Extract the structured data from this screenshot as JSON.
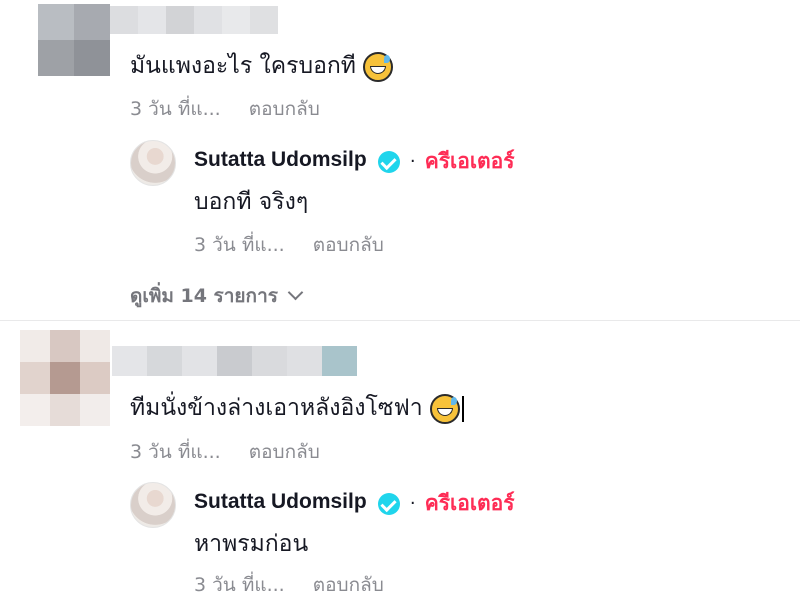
{
  "comments": [
    {
      "text": "มันแพงอะไร ใครบอกที",
      "emoji": "sweat-smile-emoji",
      "time": "3 วัน ที่แ...",
      "reply_label": "ตอบกลับ",
      "reply": {
        "author": "Sutatta Udomsilp",
        "separator": "·",
        "badge": "ครีเอเตอร์",
        "text": "บอกที จริงๆ",
        "time": "3 วัน ที่แ...",
        "reply_label": "ตอบกลับ"
      },
      "view_more": "ดูเพิ่ม 14 รายการ"
    },
    {
      "text": "ทีมนั่งข้างล่างเอาหลังอิงโซฟา",
      "emoji": "sweat-smile-emoji",
      "time": "3 วัน ที่แ...",
      "reply_label": "ตอบกลับ",
      "reply": {
        "author": "Sutatta Udomsilp",
        "separator": "·",
        "badge": "ครีเอเตอร์",
        "text": "หาพรมก่อน",
        "time": "3 วัน ที่แ...",
        "reply_label": "ตอบกลับ"
      }
    }
  ],
  "colors": {
    "creator_badge": "#fe2c55",
    "verified": "#20d5ec",
    "meta_text": "#8a8b91"
  }
}
